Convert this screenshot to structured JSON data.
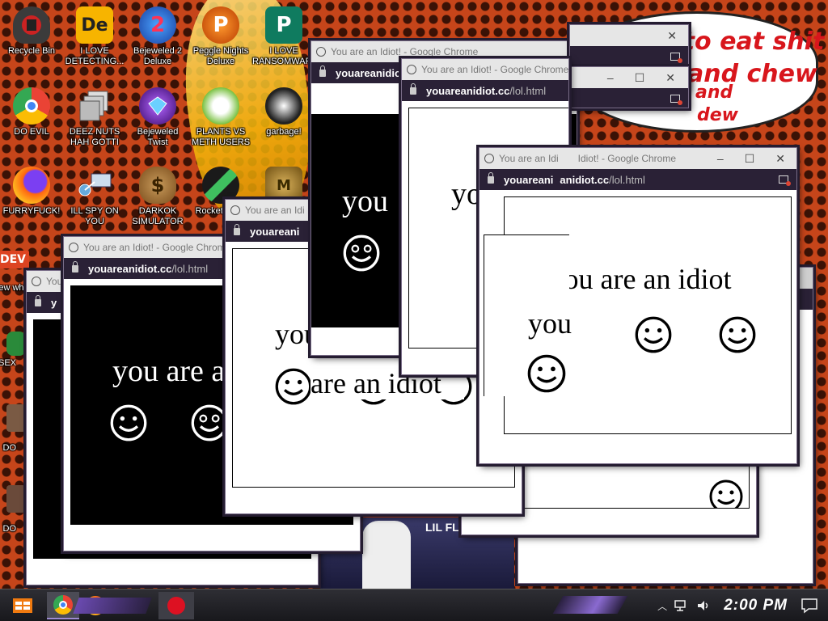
{
  "wallpaper": {
    "speech_lines": [
      "time to eat shit",
      "and chew",
      "and",
      "dew"
    ],
    "colors": {
      "background": "#c6451a",
      "dots": "#3a1206",
      "speech_text": "#d8161c"
    }
  },
  "desktop_icons": [
    {
      "label": "Recycle Bin",
      "icon": "recycle-bin-icon"
    },
    {
      "label": "I LOVE DETECTING...",
      "icon": "de-app-icon"
    },
    {
      "label": "Bejeweled 2 Deluxe",
      "icon": "bejeweled-icon"
    },
    {
      "label": "Peggle Nights Deluxe",
      "icon": "peggle-icon"
    },
    {
      "label": "I LOVE RANSOMWARE",
      "icon": "publisher-icon"
    },
    {
      "label": "DO EVIL",
      "icon": "chrome-icon"
    },
    {
      "label": "DEEZ NUTS HAH GOTTI",
      "icon": "windows-stack-icon"
    },
    {
      "label": "Bejeweled Twist",
      "icon": "bejeweled-twist-icon"
    },
    {
      "label": "PLANTS VS METH USERS",
      "icon": "plants-vs-zombies-icon"
    },
    {
      "label": "garbage!",
      "icon": "garbage-game-icon"
    },
    {
      "label": "FURRYFUCK!",
      "icon": "firefox-icon"
    },
    {
      "label": "ILL SPY ON YOU",
      "icon": "network-spy-icon"
    },
    {
      "label": "DARKOK SIMULATOR",
      "icon": "money-bag-icon"
    },
    {
      "label": "Rocket Del...",
      "icon": "rocket-icon"
    },
    {
      "label": "",
      "icon": "coin-game-icon"
    },
    {
      "label": "new whi",
      "icon": "dev-icon"
    },
    {
      "label": "SEX",
      "icon": "green-app-icon"
    },
    {
      "label": "DO",
      "icon": "person-photo-icon"
    },
    {
      "label": "DO",
      "icon": "person-photo-icon"
    }
  ],
  "popup": {
    "tab_title": "You are an Idiot! - Google Chrome",
    "tab_title_short": "You are an Idi",
    "tab_title_tail": "Idiot! - Google Chrome",
    "host": "youareanidiot.cc",
    "path": "/lol.html",
    "host_cut_a": "youareanidiot.c",
    "host_cut_b": "youareani",
    "host_tail": "anidiot.cc",
    "host_cut_c": "y",
    "message": "you are an idiot",
    "message_short": "you",
    "message_partial": "you are a",
    "message_mid": "are an idiot",
    "message_yo": "yo",
    "message_tail": "ou are an idiot",
    "controls": {
      "minimize": "–",
      "maximize": "☐",
      "close": "✕"
    }
  },
  "taskbar": {
    "clock": "2:00 PM",
    "pinned": [
      "start-button-icon",
      "chrome-icon",
      "firefox-icon",
      "file-explorer-icon",
      "red-app-icon"
    ],
    "active": "chrome-icon"
  }
}
